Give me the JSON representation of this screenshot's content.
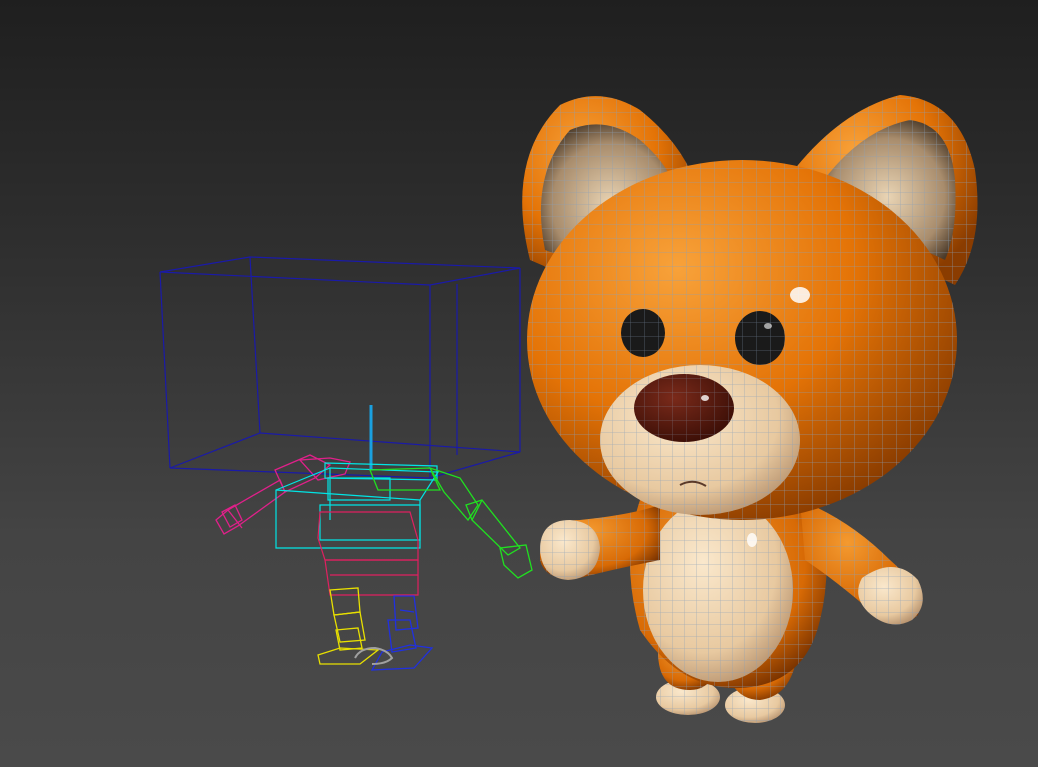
{
  "viewport": {
    "background_top": "#1f1f1f",
    "background_bottom": "#4a4a4a"
  },
  "scene": {
    "rig": {
      "bounding_box_color": "#1a1aa8",
      "spine_color": "#00e5e5",
      "left_arm_color": "#e0208a",
      "right_arm_color": "#20e020",
      "left_leg_color": "#e8e000",
      "right_leg_color": "#2030e0",
      "pelvis_color": "#e02060",
      "root_marker_color": "#1aa0e0",
      "foot_ring_color": "#a0a0a0"
    },
    "character": {
      "fur_color": "#e8790a",
      "fur_highlight": "#f7a040",
      "belly_color": "#f2d9b4",
      "nose_color": "#5a1a10",
      "eye_color": "#1a1a1a",
      "wire_color": "#8aa0b8"
    }
  }
}
